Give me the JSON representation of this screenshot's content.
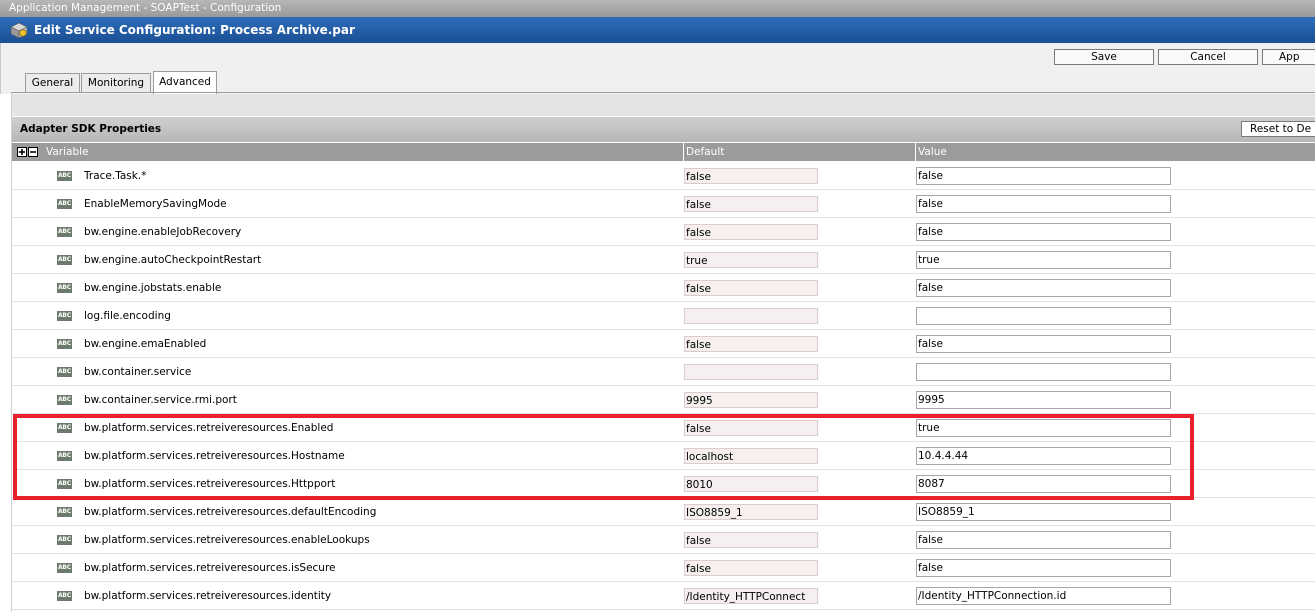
{
  "breadcrumb": "Application Management - SOAPTest - Configuration",
  "window": {
    "title": "Edit Service Configuration: Process Archive.par"
  },
  "toolbar": {
    "save_label": "Save",
    "cancel_label": "Cancel",
    "apply_label": "App"
  },
  "tabs": [
    {
      "label": "General",
      "active": false
    },
    {
      "label": "Monitoring",
      "active": false
    },
    {
      "label": "Advanced",
      "active": true
    }
  ],
  "section": {
    "title": "Adapter SDK Properties",
    "reset_label": "Reset to De"
  },
  "columns": {
    "variable": "Variable",
    "default": "Default",
    "value": "Value"
  },
  "icons": {
    "type_badge": "ABC",
    "app_icon": "service-config-icon",
    "expand_all": "expand-all-icon",
    "collapse_all": "collapse-all-icon"
  },
  "colors": {
    "title_bar": "#2a62ab",
    "highlight": "#e8212c",
    "header_grey": "#9b9b9b"
  },
  "rows": [
    {
      "variable": "Trace.Task.*",
      "default": "false",
      "value": "false"
    },
    {
      "variable": "EnableMemorySavingMode",
      "default": "false",
      "value": "false"
    },
    {
      "variable": "bw.engine.enableJobRecovery",
      "default": "false",
      "value": "false"
    },
    {
      "variable": "bw.engine.autoCheckpointRestart",
      "default": "true",
      "value": "true"
    },
    {
      "variable": "bw.engine.jobstats.enable",
      "default": "false",
      "value": "false"
    },
    {
      "variable": "log.file.encoding",
      "default": "",
      "value": ""
    },
    {
      "variable": "bw.engine.emaEnabled",
      "default": "false",
      "value": "false"
    },
    {
      "variable": "bw.container.service",
      "default": "",
      "value": ""
    },
    {
      "variable": "bw.container.service.rmi.port",
      "default": "9995",
      "value": "9995"
    },
    {
      "variable": "bw.platform.services.retreiveresources.Enabled",
      "default": "false",
      "value": "true"
    },
    {
      "variable": "bw.platform.services.retreiveresources.Hostname",
      "default": "localhost",
      "value": "10.4.4.44"
    },
    {
      "variable": "bw.platform.services.retreiveresources.Httpport",
      "default": "8010",
      "value": "8087"
    },
    {
      "variable": "bw.platform.services.retreiveresources.defaultEncoding",
      "default": "ISO8859_1",
      "value": "ISO8859_1"
    },
    {
      "variable": "bw.platform.services.retreiveresources.enableLookups",
      "default": "false",
      "value": "false"
    },
    {
      "variable": "bw.platform.services.retreiveresources.isSecure",
      "default": "false",
      "value": "false"
    },
    {
      "variable": "bw.platform.services.retreiveresources.identity",
      "default": "/Identity_HTTPConnect",
      "value": "/Identity_HTTPConnection.id"
    }
  ]
}
